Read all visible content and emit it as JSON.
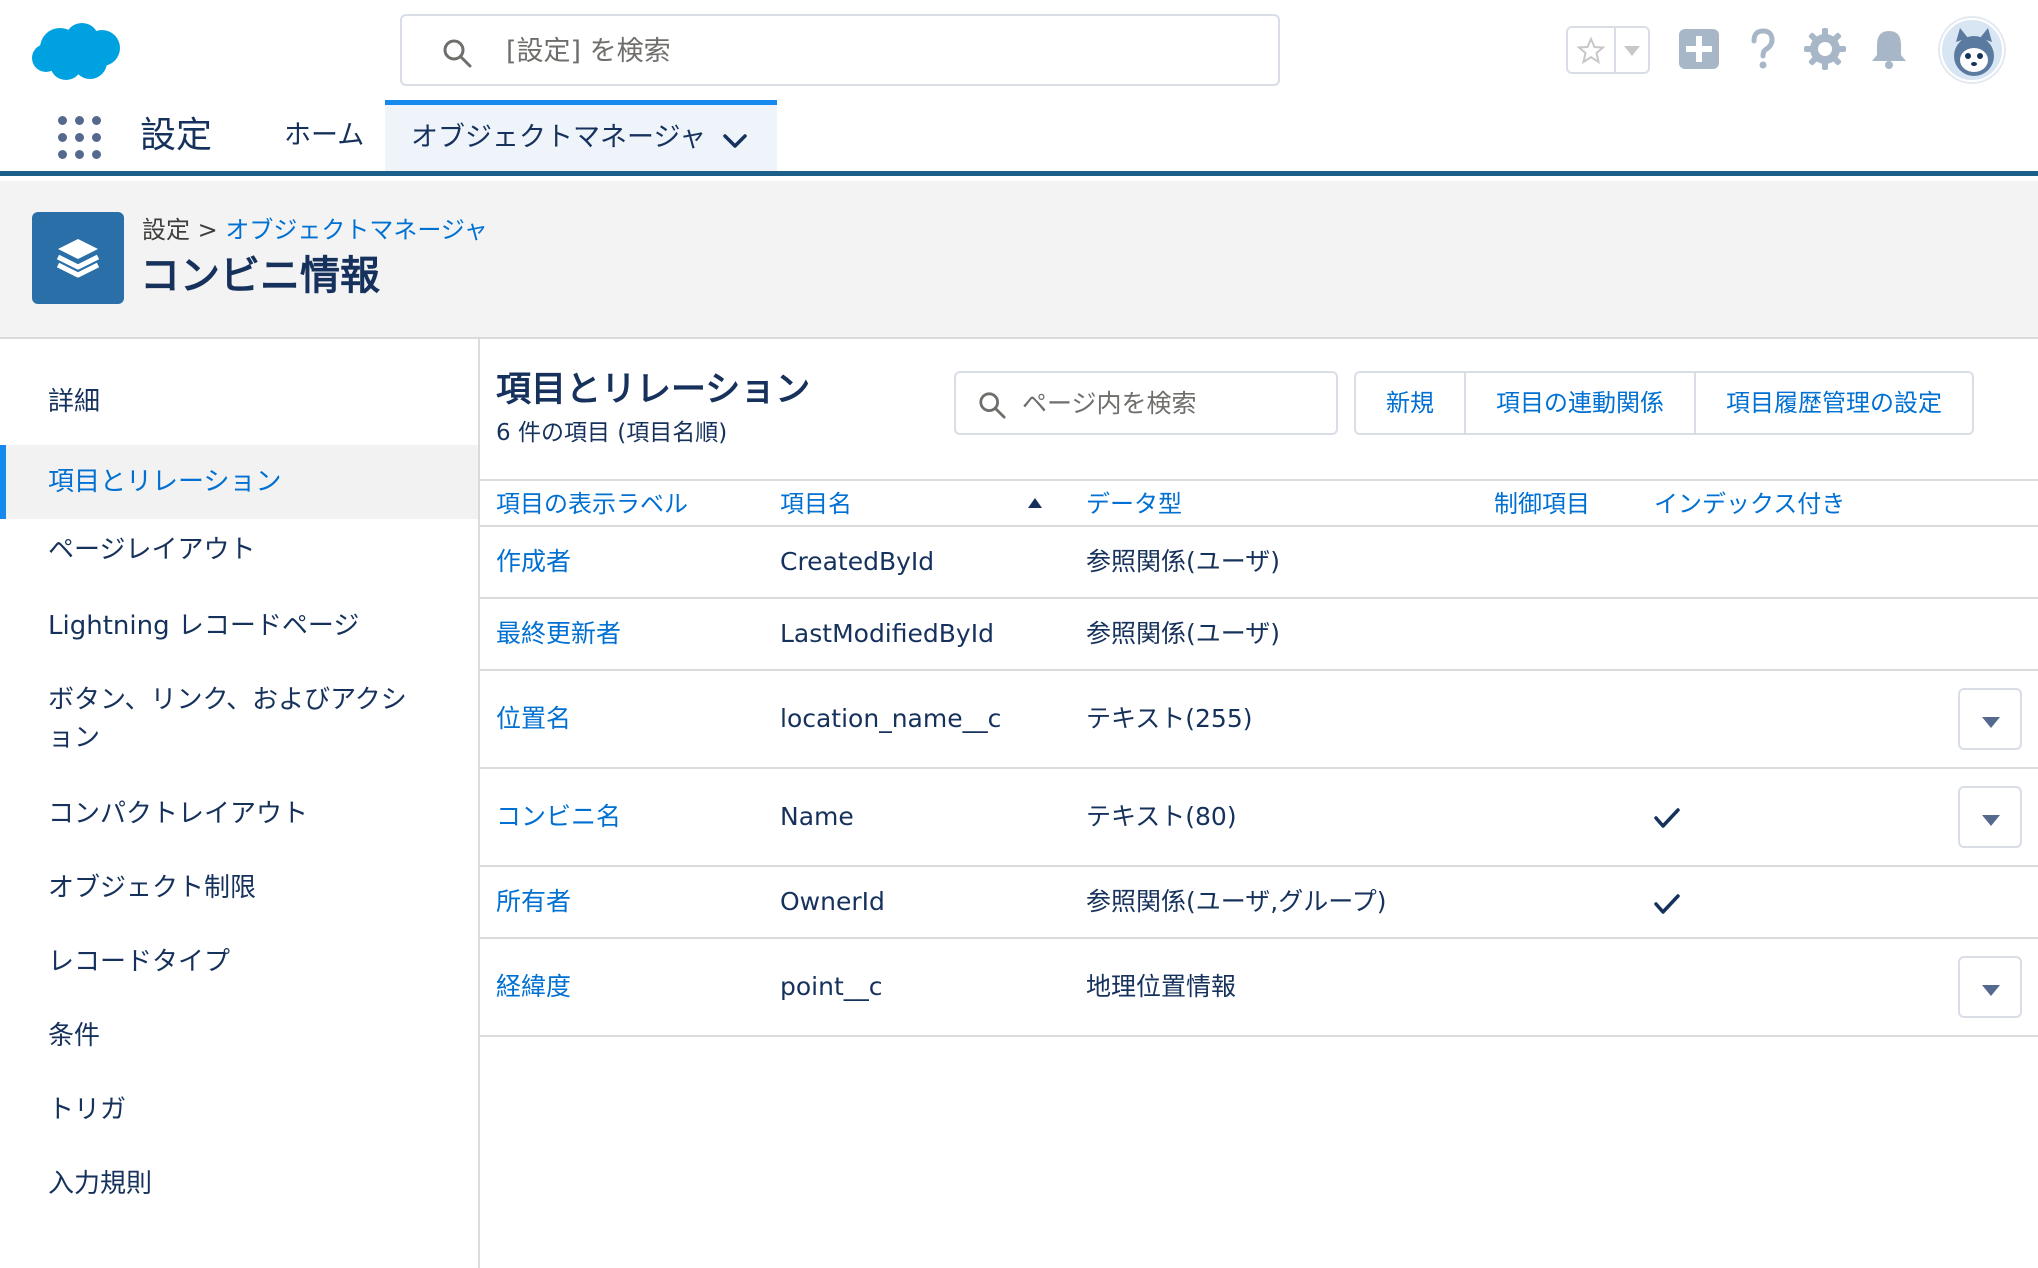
{
  "header": {
    "search_placeholder": "[設定] を検索"
  },
  "nav": {
    "app_name": "設定",
    "home": "ホーム",
    "active_tab": "オブジェクトマネージャ"
  },
  "page_header": {
    "breadcrumb_root": "設定",
    "breadcrumb_sep": " > ",
    "breadcrumb_link": "オブジェクトマネージャ",
    "title": "コンビニ情報"
  },
  "sidebar": {
    "items": [
      {
        "label": "詳細"
      },
      {
        "label": "項目とリレーション"
      },
      {
        "label": "ページレイアウト"
      },
      {
        "label": "Lightning レコードページ"
      },
      {
        "label": "ボタン、リンク、およびアクション"
      },
      {
        "label": "コンパクトレイアウト"
      },
      {
        "label": "オブジェクト制限"
      },
      {
        "label": "レコードタイプ"
      },
      {
        "label": "条件"
      },
      {
        "label": "トリガ"
      },
      {
        "label": "入力規則"
      }
    ],
    "active_index": 1
  },
  "main": {
    "title": "項目とリレーション",
    "subtitle": "6 件の項目 (項目名順)",
    "search_placeholder": "ページ内を検索",
    "buttons": {
      "new": "新規",
      "dependencies": "項目の連動関係",
      "history": "項目履歴管理の設定"
    },
    "columns": {
      "label": "項目の表示ラベル",
      "api_name": "項目名",
      "data_type": "データ型",
      "controlling": "制御項目",
      "indexed": "インデックス付き"
    },
    "rows": [
      {
        "label": "作成者",
        "api_name": "CreatedById",
        "data_type": "参照関係(ユーザ)",
        "controlling": "",
        "indexed": false,
        "menu": false
      },
      {
        "label": "最終更新者",
        "api_name": "LastModifiedById",
        "data_type": "参照関係(ユーザ)",
        "controlling": "",
        "indexed": false,
        "menu": false
      },
      {
        "label": "位置名",
        "api_name": "location_name__c",
        "data_type": "テキスト(255)",
        "controlling": "",
        "indexed": false,
        "menu": true
      },
      {
        "label": "コンビニ名",
        "api_name": "Name",
        "data_type": "テキスト(80)",
        "controlling": "",
        "indexed": true,
        "menu": true
      },
      {
        "label": "所有者",
        "api_name": "OwnerId",
        "data_type": "参照関係(ユーザ,グループ)",
        "controlling": "",
        "indexed": true,
        "menu": false
      },
      {
        "label": "経緯度",
        "api_name": "point__c",
        "data_type": "地理位置情報",
        "controlling": "",
        "indexed": false,
        "menu": true
      }
    ]
  },
  "colors": {
    "brand": "#0070d2",
    "nav_border": "#1b5f8a",
    "logo": "#00a1e0",
    "object_icon": "#2a6fa7"
  },
  "icons": [
    "salesforce-logo",
    "search-icon",
    "star-icon",
    "add-icon",
    "help-icon",
    "gear-icon",
    "bell-icon",
    "avatar",
    "app-launcher-icon",
    "chevron-down-icon",
    "layers-icon",
    "check-icon",
    "dropdown-menu-icon"
  ]
}
